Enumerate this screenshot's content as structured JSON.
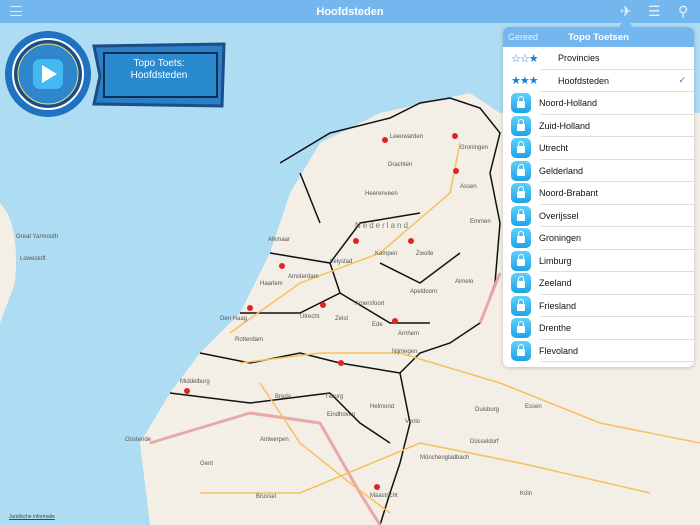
{
  "topbar": {
    "title": "Hoofdsteden",
    "icons": [
      "menu-icon",
      "netherlands-map-icon",
      "layers-icon",
      "location-pin-icon"
    ]
  },
  "badge": {
    "line1": "Topo Toets:",
    "line2": "Hoofdsteden"
  },
  "popover": {
    "done_label": "Gereed",
    "title": "Topo Toetsen",
    "items": [
      {
        "label": "Provincies",
        "icon": "three-stars-outline",
        "checked": false
      },
      {
        "label": "Hoofdsteden",
        "icon": "three-stars-filled",
        "checked": true
      },
      {
        "label": "Noord-Holland",
        "icon": "lock"
      },
      {
        "label": "Zuid-Holland",
        "icon": "lock"
      },
      {
        "label": "Utrecht",
        "icon": "lock"
      },
      {
        "label": "Gelderland",
        "icon": "lock"
      },
      {
        "label": "Noord-Brabant",
        "icon": "lock"
      },
      {
        "label": "Overijssel",
        "icon": "lock"
      },
      {
        "label": "Groningen",
        "icon": "lock"
      },
      {
        "label": "Limburg",
        "icon": "lock"
      },
      {
        "label": "Zeeland",
        "icon": "lock"
      },
      {
        "label": "Friesland",
        "icon": "lock"
      },
      {
        "label": "Drenthe",
        "icon": "lock"
      },
      {
        "label": "Flevoland",
        "icon": "lock"
      }
    ],
    "checkmark": "✓"
  },
  "map": {
    "cities": [
      "Leeuwarden",
      "Groningen",
      "Drachten",
      "Heerenveen",
      "Assen",
      "Emmen",
      "Lelystad",
      "Zwolle",
      "Kampen",
      "Almelo",
      "Alkmaar",
      "Amsterdam",
      "Haarlem",
      "Den Haag",
      "Rotterdam",
      "Utrecht",
      "Amersfoort",
      "Apeldoorn",
      "Ede",
      "Arnhem",
      "Nijmegen",
      "Zeist",
      "Breda",
      "Tilburg",
      "Eindhoven",
      "Helmond",
      "Venlo",
      "Maastricht",
      "Middelburg",
      "Antwerpen",
      "Brussel",
      "Gent",
      "Oostende",
      "Duisburg",
      "Essen",
      "Düsseldorf",
      "Köln",
      "Mönchengladbach",
      "Great Yarmouth",
      "Lowestoft",
      "Nederland"
    ],
    "legal": "Juridische informatie"
  },
  "colors": {
    "bar": "#74b6ee",
    "sea": "#aedcf3",
    "land": "#f4efe6",
    "pin": "#e52222",
    "accent": "#1a7fe0"
  }
}
